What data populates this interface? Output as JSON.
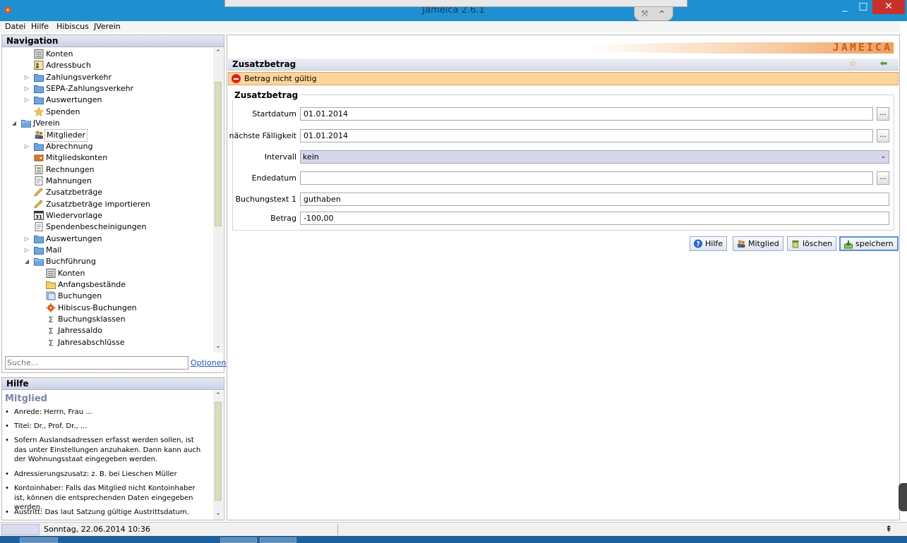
{
  "window": {
    "title": "Jameica 2.6.1",
    "minimize_label": "_",
    "maximize_label": "□",
    "close_label": "✕",
    "overlay_left": "⤧",
    "overlay_right": "^"
  },
  "menu": [
    "Datei",
    "Hilfe",
    "Hibiscus",
    "JVerein"
  ],
  "navigation": {
    "title": "Navigation",
    "items": [
      {
        "label": "Konten",
        "icon": "ledger-icon",
        "indent": 3,
        "toggle": ""
      },
      {
        "label": "Adressbuch",
        "icon": "addressbook-icon",
        "indent": 3,
        "toggle": ""
      },
      {
        "label": "Zahlungsverkehr",
        "icon": "folder-icon",
        "indent": 3,
        "toggle": "▷"
      },
      {
        "label": "SEPA-Zahlungsverkehr",
        "icon": "folder-icon",
        "indent": 3,
        "toggle": "▷"
      },
      {
        "label": "Auswertungen",
        "icon": "folder-icon",
        "indent": 3,
        "toggle": "▷"
      },
      {
        "label": "Spenden",
        "icon": "star-icon",
        "indent": 3,
        "toggle": ""
      },
      {
        "label": "JVerein",
        "icon": "folder-open-icon",
        "indent": 2,
        "toggle": "◢"
      },
      {
        "label": "Mitglieder",
        "icon": "members-icon",
        "indent": 3,
        "toggle": "",
        "selected": true
      },
      {
        "label": "Abrechnung",
        "icon": "folder-icon",
        "indent": 3,
        "toggle": "▷"
      },
      {
        "label": "Mitgliedskonten",
        "icon": "wallet-icon",
        "indent": 3,
        "toggle": ""
      },
      {
        "label": "Rechnungen",
        "icon": "invoice-icon",
        "indent": 3,
        "toggle": ""
      },
      {
        "label": "Mahnungen",
        "icon": "document-icon",
        "indent": 3,
        "toggle": ""
      },
      {
        "label": "Zusatzbeträge",
        "icon": "pencil-icon",
        "indent": 3,
        "toggle": ""
      },
      {
        "label": "Zusatzbeträge importieren",
        "icon": "pencil-icon",
        "indent": 3,
        "toggle": ""
      },
      {
        "label": "Wiedervorlage",
        "icon": "calendar-icon",
        "indent": 3,
        "toggle": ""
      },
      {
        "label": "Spendenbescheinigungen",
        "icon": "document-icon",
        "indent": 3,
        "toggle": ""
      },
      {
        "label": "Auswertungen",
        "icon": "folder-icon",
        "indent": 3,
        "toggle": "▷"
      },
      {
        "label": "Mail",
        "icon": "folder-icon",
        "indent": 3,
        "toggle": "▷"
      },
      {
        "label": "Buchführung",
        "icon": "folder-open-icon",
        "indent": 3,
        "toggle": "◢"
      },
      {
        "label": "Konten",
        "icon": "ledger-icon",
        "indent": 4,
        "toggle": ""
      },
      {
        "label": "Anfangsbestände",
        "icon": "folder-yellow-icon",
        "indent": 4,
        "toggle": ""
      },
      {
        "label": "Buchungen",
        "icon": "bookings-icon",
        "indent": 4,
        "toggle": ""
      },
      {
        "label": "Hibiscus-Buchungen",
        "icon": "hibiscus-icon",
        "indent": 4,
        "toggle": ""
      },
      {
        "label": "Buchungsklassen",
        "icon": "sigma-icon",
        "indent": 4,
        "toggle": ""
      },
      {
        "label": "Jahressaldo",
        "icon": "sigma-icon",
        "indent": 4,
        "toggle": ""
      },
      {
        "label": "Jahresabschlüsse",
        "icon": "sigma-icon",
        "indent": 4,
        "toggle": ""
      }
    ],
    "search_placeholder": "Suche...",
    "options_label": "Optionen"
  },
  "help": {
    "title": "Hilfe",
    "subtitle": "Mitglied",
    "items": [
      "Anrede: Herrn, Frau ...",
      "Titel: Dr., Prof. Dr., ...",
      "Sofern Auslandsadressen erfasst werden sollen, ist das unter Einstellungen anzuhaken. Dann kann auch der Wohnungsstaat eingegeben werden.",
      "Adressierungszusatz: z. B. bei Lieschen Müller",
      "Kontoinhaber: Falls das Mitglied nicht Kontoinhaber ist, können die entsprechenden Daten eingegeben werden.",
      "Austritt: Das laut Satzung gültige Austrittsdatum."
    ]
  },
  "main": {
    "logo_text": "JAMEICA",
    "view_title": "Zusatzbetrag",
    "error_message": "Betrag nicht gültig",
    "group_title": "Zusatzbetrag",
    "fields": {
      "startdatum": {
        "label": "Startdatum",
        "value": "01.01.2014"
      },
      "faelligkeit": {
        "label": "nächste Fälligkeit",
        "value": "01.01.2014"
      },
      "intervall": {
        "label": "Intervall",
        "value": "kein"
      },
      "endedatum": {
        "label": "Endedatum",
        "value": ""
      },
      "buchungstext": {
        "label": "Buchungstext 1",
        "value": "guthaben"
      },
      "betrag": {
        "label": "Betrag",
        "value": "-100,00"
      }
    },
    "picker_label": "...",
    "buttons": {
      "hilfe": "Hilfe",
      "mitglied": "Mitglied",
      "loeschen": "löschen",
      "speichern": "speichern"
    }
  },
  "status": {
    "datetime": "Sonntag, 22.06.2014 10:36",
    "arrow": "⇞"
  },
  "colors": {
    "titlebar": "#1e8fd0",
    "error_bg": "#fcd59c",
    "close_red": "#c7302b",
    "logo_orange": "#c4611a"
  }
}
